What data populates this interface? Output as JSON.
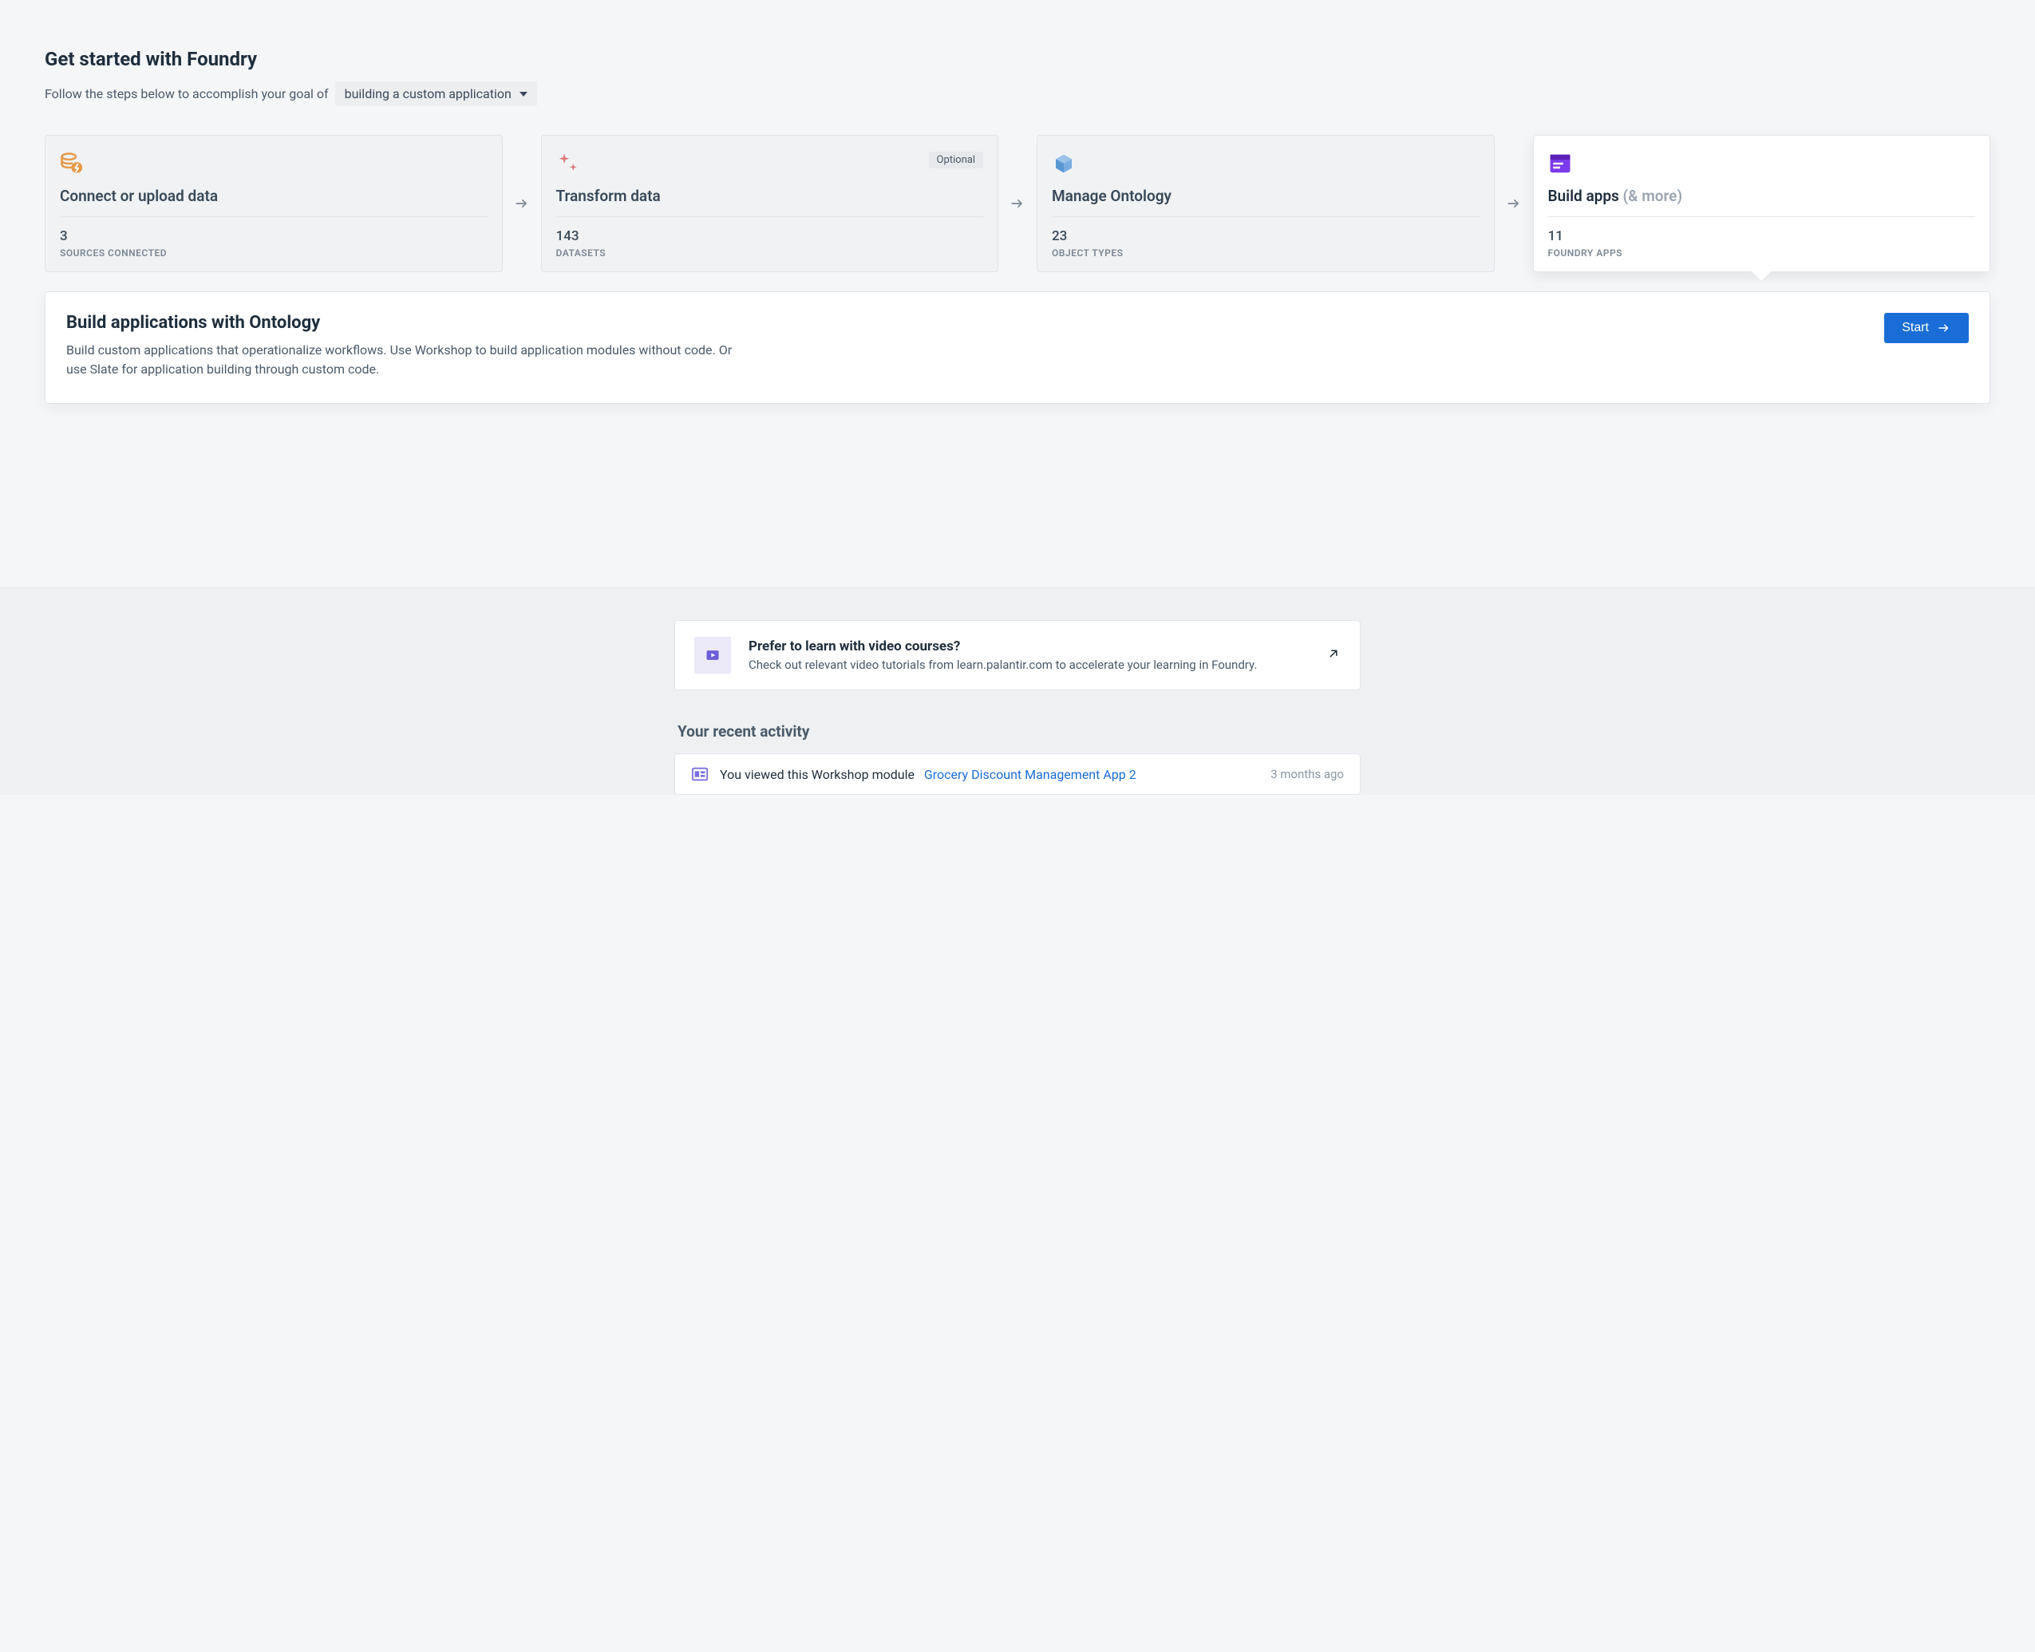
{
  "header": {
    "title": "Get started with Foundry",
    "subtitle_prefix": "Follow the steps below to accomplish your goal of",
    "goal_selected": "building a custom application"
  },
  "steps": [
    {
      "title": "Connect or upload data",
      "count": "3",
      "count_label": "SOURCES CONNECTED",
      "optional": false
    },
    {
      "title": "Transform data",
      "count": "143",
      "count_label": "DATASETS",
      "optional": true
    },
    {
      "title": "Manage Ontology",
      "count": "23",
      "count_label": "OBJECT TYPES",
      "optional": false
    },
    {
      "title": "Build apps",
      "title_suffix": "(& more)",
      "count": "11",
      "count_label": "FOUNDRY APPS",
      "optional": false
    }
  ],
  "detail": {
    "title": "Build applications with Ontology",
    "description": "Build custom applications that operationalize workflows. Use Workshop to build application modules without code. Or use Slate for application building through custom code.",
    "start_label": "Start"
  },
  "optional_badge": "Optional",
  "video_card": {
    "title": "Prefer to learn with video courses?",
    "description": "Check out relevant video tutorials from learn.palantir.com to accelerate your learning in Foundry."
  },
  "activity": {
    "heading": "Your recent activity",
    "items": [
      {
        "prefix": "You viewed this Workshop module",
        "link_text": "Grocery Discount Management App 2",
        "time": "3 months ago"
      }
    ]
  }
}
